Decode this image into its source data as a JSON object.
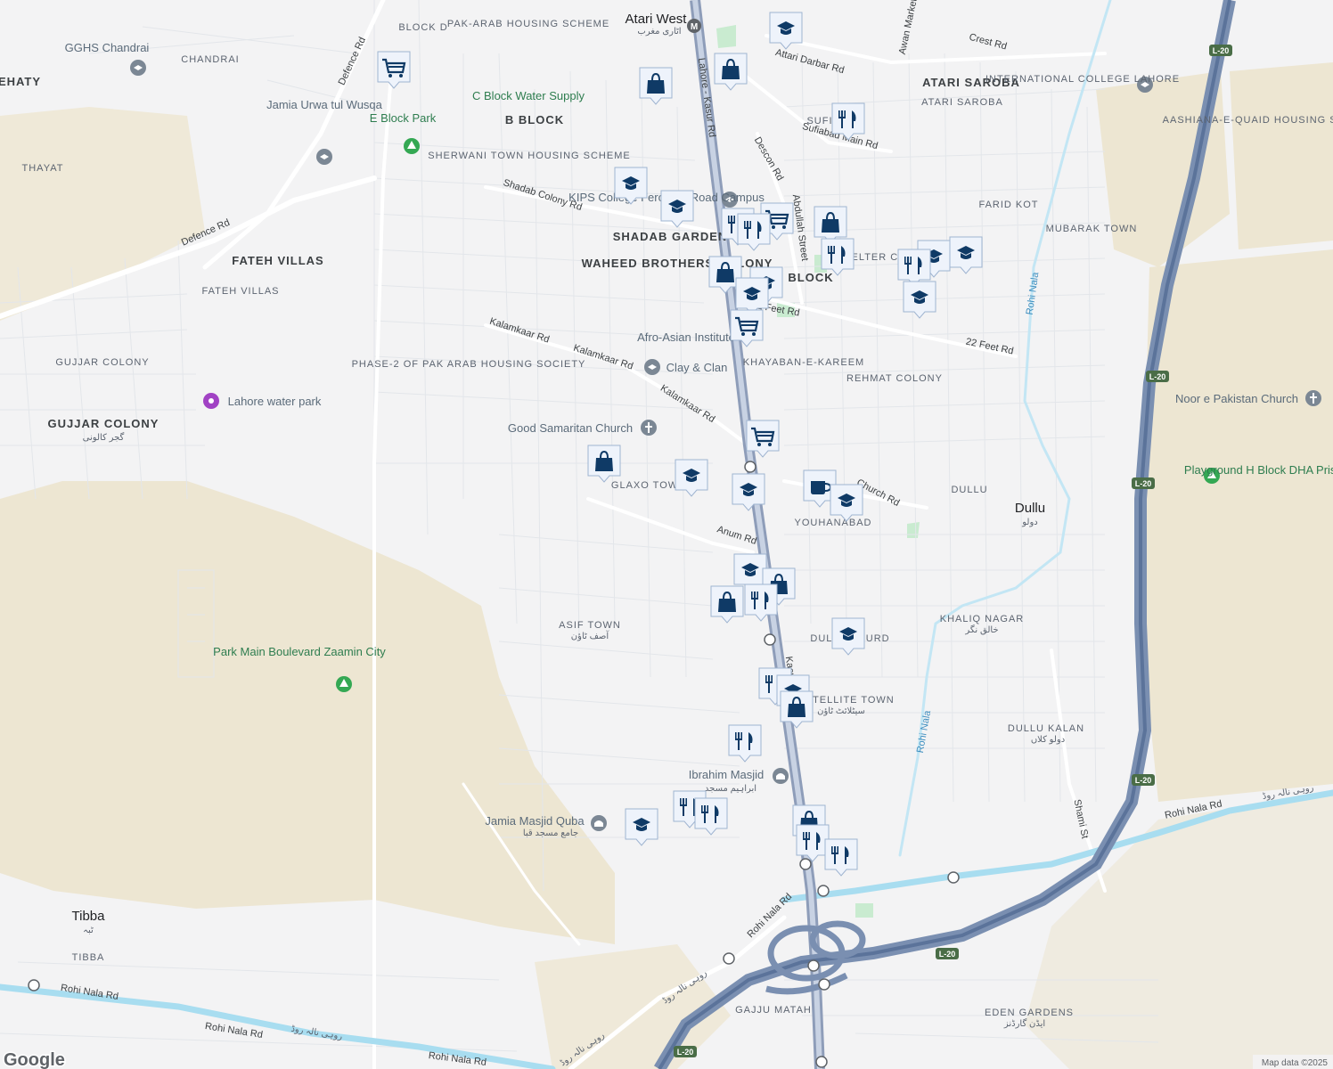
{
  "map": {
    "attribution": "Map data ©2025",
    "logo": "Google",
    "colors": {
      "background": "#f3f3f4",
      "roads": "#ffffff",
      "highway": "#7a8fb1",
      "highway_core": "#5b739a",
      "canal": "#a8ddf0",
      "farmland": "#ede6d2",
      "park": "#c9ebd0",
      "pin": "#0f3a66"
    }
  },
  "labels": {
    "atari_west": "Atari West",
    "atari_west_ur": "اٹاری مغرب",
    "pak_arab_housing_scheme": "PAK-ARAB HOUSING SCHEME",
    "block_d": "BLOCK D",
    "gghs_chandrai": "GGHS Chandrai",
    "chandrai": "CHANDRAI",
    "ehaty": "EHATY",
    "defence_rd": "Defence Rd",
    "jamia_urwa": "Jamia Urwa tul Wusqa",
    "e_block_park": "E Block Park",
    "thayat": "THAYAT",
    "c_block_water_supply": "C Block Water Supply",
    "b_block": "B BLOCK",
    "sherwani": "SHERWANI TOWN HOUSING SCHEME",
    "shadab_colony_rd": "Shadab Colony Rd",
    "fateh_villas_b": "FATEH VILLAS",
    "fateh_villas": "FATEH VILLAS",
    "kipp": "KIPS College Ferozpur Road Campus",
    "shadab_garden": "SHADAB GARDEN",
    "waheed_brothers": "WAHEED BROTHERS COLONY",
    "gujjar_colony": "GUJJAR COLONY",
    "gujjar_colony_b": "GUJJAR COLONY",
    "gujjar_colony_ur": "گجر کالونی",
    "lahore_water_park": "Lahore water park",
    "kalamkaar_rd": "Kalamkaar Rd",
    "phase2": "PHASE-2 OF PAK ARAB HOUSING SOCIETY",
    "clay_clan": "Clay & Clan",
    "afro_asian": "Afro-Asian Institute",
    "khayaban": "KHAYABAN-E-KAREEM",
    "good_samaritan": "Good Samaritan Church",
    "glaxo_town": "GLAXO TOWN",
    "lahore_kasur_rd": "Lahore - Kasur Rd",
    "kasur_rd": "Kasur Rd",
    "attari_darbar_rd": "Attari Darbar Rd",
    "atari_saroba_b": "ATARI SAROBA",
    "atari_saroba": "ATARI SAROBA",
    "crest_rd": "Crest Rd",
    "awan_market": "Awan Market Rd",
    "international_college": "INTERNATIONAL COLLEGE LAHORE",
    "aashiana": "AASHIANA-E-QUAID HOUSING SCHEME",
    "sufiabad_main_rd": "Sufiabad Main Rd",
    "sufi": "SUFI",
    "descon_rd": "Descon Rd",
    "abdullah_street": "Abdullah Street",
    "farid_kot": "FARID KOT",
    "mubarak_town": "MUBARAK TOWN",
    "shelter_colony": "SHELTER COLONY",
    "block": "BLOCK",
    "feet_rd": "22 Feet Rd",
    "twenty_two_feet_rd": "22 Feet Rd",
    "rehmat_colony": "REHMAT COLONY",
    "rohi_nala": "Rohi Nala",
    "noor_church": "Noor e Pakistan Church",
    "playground": "Playground H Block DHA Prism 9",
    "church_rd": "Church Rd",
    "dullu": "DULLU",
    "dullu_city": "Dullu",
    "dullu_ur": "دولو",
    "youhanabad": "YOUHANABAD",
    "anum_rd": "Anum Rd",
    "khaliq_nagar": "KHALIQ NAGAR",
    "khaliq_nagar_ur": "خالق نگر",
    "asif_town": "ASIF TOWN",
    "asif_town_ur": "آصف ٹاؤن",
    "dullu_khurd": "DULLU KHURD",
    "park_main_blvd": "Park Main Boulevard Zaamin City",
    "satellite_town": "SATELLITE TOWN",
    "satellite_town_ur": "سیٹلائٹ ٹاؤن",
    "dullu_kalan": "DULLU KALAN",
    "dullu_kalan_ur": "دولو کلاں",
    "shami_st": "Shami St",
    "ibrahim_masjid": "Ibrahim Masjid",
    "ibrahim_masjid_ur": "ابراہیم مسجد",
    "jamia_quba": "Jamia Masjid Quba",
    "jamia_quba_ur": "جامع مسجد قبا",
    "rohi_nala_rd": "Rohi Nala Rd",
    "rohi_nala_rd_ur": "روہی نالہ روڈ",
    "tibba": "Tibba",
    "tibba_ur": "ٹبہ",
    "tibba_area": "TIBBA",
    "gajju_matah": "GAJJU MATAH",
    "eden_gardens": "EDEN GARDENS",
    "eden_gardens_ur": "ایڈن گارڈنز",
    "l20": "L-20"
  }
}
